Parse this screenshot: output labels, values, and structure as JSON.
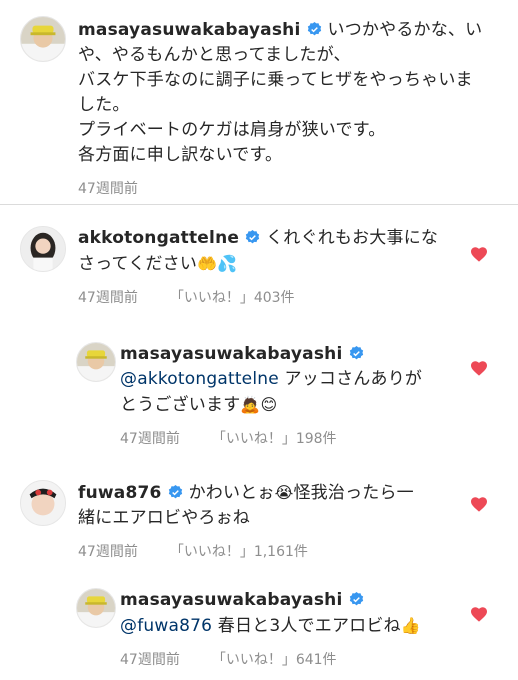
{
  "caption": {
    "username": "masayasuwakabayashi",
    "lines": [
      "いつかやるかな、い",
      "や、やるもんかと思ってましたが、",
      "バスケ下手なのに調子に乗ってヒザをやっちゃいま",
      "した。",
      "プライベートのケガは肩身が狭いです。",
      "各方面に申し訳ないです。"
    ],
    "time": "47週間前"
  },
  "comments": [
    {
      "username": "akkotongattelne",
      "lines": [
        "くれぐれもお大事にな",
        "さってください"
      ],
      "emoji": "🤲💦",
      "time": "47週間前",
      "likes": "「いいね！」403件"
    },
    {
      "username": "masayasuwakabayashi",
      "mention": "@akkotongattelne",
      "lines": [
        " アッコさんありが",
        "とうございます"
      ],
      "emoji": "🙇😊",
      "time": "47週間前",
      "likes": "「いいね！」198件"
    },
    {
      "username": "fuwa876",
      "lines": [
        "かわいとぉ",
        "怪我治ったら一",
        "緒にエアロビやろぉね"
      ],
      "emoji": "😭",
      "time": "47週間前",
      "likes": "「いいね！」1,161件"
    },
    {
      "username": "masayasuwakabayashi",
      "mention": "@fuwa876",
      "lines": [
        " 春日と3人でエアロビね"
      ],
      "emoji": "👍",
      "time": "47週間前",
      "likes": "「いいね！」641件"
    }
  ],
  "colors": {
    "verified": "#3897f0",
    "heart": "#ed4956",
    "meta": "#8e8e8e",
    "mention": "#003569"
  }
}
